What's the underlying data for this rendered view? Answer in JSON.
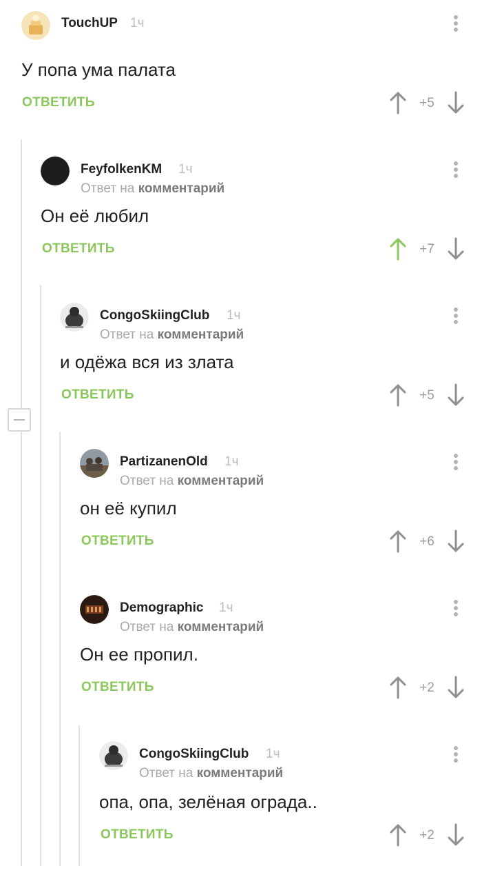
{
  "comments": [
    {
      "author": "TouchUP",
      "time": "1ч",
      "reply_to_prefix": "",
      "reply_to_target": "",
      "text": "У попа ума палата",
      "reply_label": "ОТВЕТИТЬ",
      "score": "+5",
      "upvoted": false,
      "avatar": "touchup-avatar"
    },
    {
      "author": "FeyfolkenKM",
      "time": "1ч",
      "reply_to_prefix": "Ответ на",
      "reply_to_target": "комментарий",
      "text": "Он её любил",
      "reply_label": "ОТВЕТИТЬ",
      "score": "+7",
      "upvoted": true,
      "avatar": "black-circle-avatar"
    },
    {
      "author": "CongoSkiingClub",
      "time": "1ч",
      "reply_to_prefix": "Ответ на",
      "reply_to_target": "комментарий",
      "text": "и одёжа вся из злата",
      "reply_label": "ОТВЕТИТЬ",
      "score": "+5",
      "upvoted": false,
      "avatar": "gorilla-skier-avatar"
    },
    {
      "author": "PartizanenOld",
      "time": "1ч",
      "reply_to_prefix": "Ответ на",
      "reply_to_target": "комментарий",
      "text": "он её купил",
      "reply_label": "ОТВЕТИТЬ",
      "score": "+6",
      "upvoted": false,
      "avatar": "soldiers-photo-avatar"
    },
    {
      "author": "Demographic",
      "time": "1ч",
      "reply_to_prefix": "Ответ на",
      "reply_to_target": "комментарий",
      "text": "Он ее пропил.",
      "reply_label": "ОТВЕТИТЬ",
      "score": "+2",
      "upvoted": false,
      "avatar": "dark-banner-avatar"
    },
    {
      "author": "CongoSkiingClub",
      "time": "1ч",
      "reply_to_prefix": "Ответ на",
      "reply_to_target": "комментарий",
      "text": "опа, опа, зелёная ограда..",
      "reply_label": "ОТВЕТИТЬ",
      "score": "+2",
      "upvoted": false,
      "avatar": "gorilla-skier-avatar"
    }
  ],
  "colors": {
    "accent_green": "#8ac858",
    "upvoted_arrow": "#8ac858",
    "arrow": "#8e8e8e",
    "thread_line": "#e1e1e1"
  }
}
